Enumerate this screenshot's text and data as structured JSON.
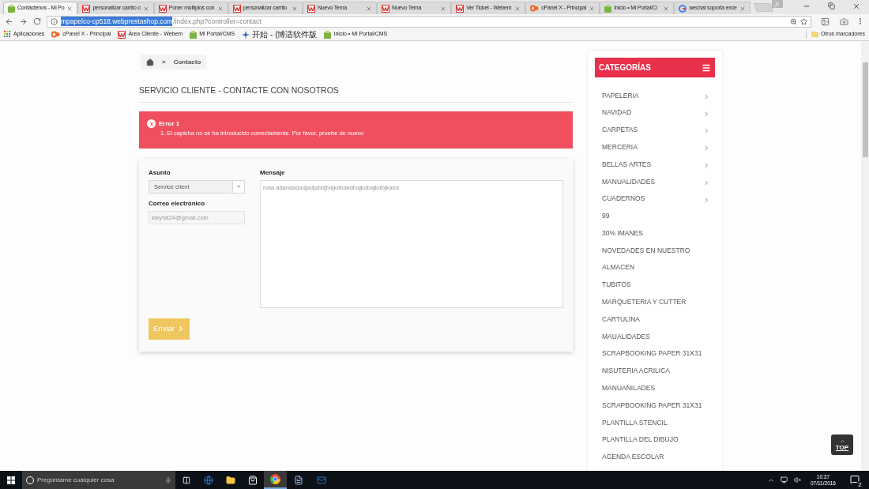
{
  "tabs": [
    {
      "title": "Contáctenos - Mi Po",
      "kind": "leaf",
      "selected": true
    },
    {
      "title": "personalizar carrito c",
      "kind": "w",
      "selected": false
    },
    {
      "title": "Poner múltiplos con",
      "kind": "w",
      "selected": false
    },
    {
      "title": "personalizar carrito",
      "kind": "w",
      "selected": false
    },
    {
      "title": "Nuevo Tema",
      "kind": "w",
      "selected": false
    },
    {
      "title": "Nuevo Tema",
      "kind": "w",
      "selected": false
    },
    {
      "title": "Ver Ticket - Webem",
      "kind": "w",
      "selected": false
    },
    {
      "title": "cPanel X - Principal",
      "kind": "cp",
      "selected": false
    },
    {
      "title": "Inicio • Mi Portal/Ci",
      "kind": "leaf",
      "selected": false
    },
    {
      "title": "wechat soporta exce",
      "kind": "g",
      "selected": false
    }
  ],
  "address_bar": {
    "host": "mpapelco-cp518.webprestashop.com",
    "path": "/index.php?controller=contact"
  },
  "bookmarks": [
    {
      "label": "Aplicaciones",
      "kind": "apps"
    },
    {
      "label": "cPanel X - Principal",
      "kind": "cp"
    },
    {
      "label": "Área Cliente - Webem",
      "kind": "w"
    },
    {
      "label": "Mi Portal/CMS",
      "kind": "leaf"
    },
    {
      "label": "开始 - (博适软件版",
      "kind": "star"
    },
    {
      "label": "Inicio • Mi Portal/CMS",
      "kind": "leaf"
    }
  ],
  "other_bookmarks": "Otros marcadores",
  "breadcrumb": {
    "current": "Contacto",
    "separator": ">"
  },
  "heading": "SERVICIO CLIENTE - CONTACTE CON NOSOTROS",
  "error": {
    "title": "Error 1",
    "message": "1. El capicha no se ha introducido correctamente. Por favor, pruebe de nuevo"
  },
  "form": {
    "subject_label": "Asunto",
    "subject_value": "Service client",
    "email_label": "Correo electrónico",
    "email_value": "kleyfat24@gmail.com",
    "message_label": "Mensaje",
    "message_value": "hola adandadadjadjabdjbajkdbakdbajkdbajkdbjkabd",
    "submit": "Enviar"
  },
  "categories": {
    "title": "CATEGORÍAS",
    "items": [
      {
        "label": "PAPELERIA",
        "has_children": true
      },
      {
        "label": "NAVIDAD",
        "has_children": true
      },
      {
        "label": "CARPETAS",
        "has_children": true
      },
      {
        "label": "MERCERIA",
        "has_children": true
      },
      {
        "label": "BELLAS ARTES",
        "has_children": true
      },
      {
        "label": "MANUALIDADES",
        "has_children": true
      },
      {
        "label": "CUADERNOS",
        "has_children": true
      },
      {
        "label": "99",
        "has_children": false
      },
      {
        "label": "30% IMANES",
        "has_children": false
      },
      {
        "label": "NOVEDADES EN NUESTRO",
        "has_children": false
      },
      {
        "label": "ALMACEN",
        "has_children": false
      },
      {
        "label": "TUBITOS",
        "has_children": false
      },
      {
        "label": "MARQUETERIA Y CUTTER",
        "has_children": false
      },
      {
        "label": "CARTULINA",
        "has_children": false
      },
      {
        "label": "MAUALIDADES",
        "has_children": false
      },
      {
        "label": "SCRAPBOOKING PAPER 31X31",
        "has_children": false
      },
      {
        "label": "NISUTERIA ACRILICA",
        "has_children": false
      },
      {
        "label": "MANUANILADES",
        "has_children": false
      },
      {
        "label": "SCRAPBOOKING PAPER 31X31",
        "has_children": false
      },
      {
        "label": "PLANTILLA STENCIL",
        "has_children": false
      },
      {
        "label": "PLANTILLA DEL DIBUJO",
        "has_children": false
      },
      {
        "label": "AGENDA ESCOLAR",
        "has_children": false
      }
    ]
  },
  "top_button": "TOP",
  "taskbar": {
    "search_placeholder": "Pregúntame cualquier cosa",
    "time": "10:37",
    "date": "07/11/2016",
    "notifications": "2"
  }
}
